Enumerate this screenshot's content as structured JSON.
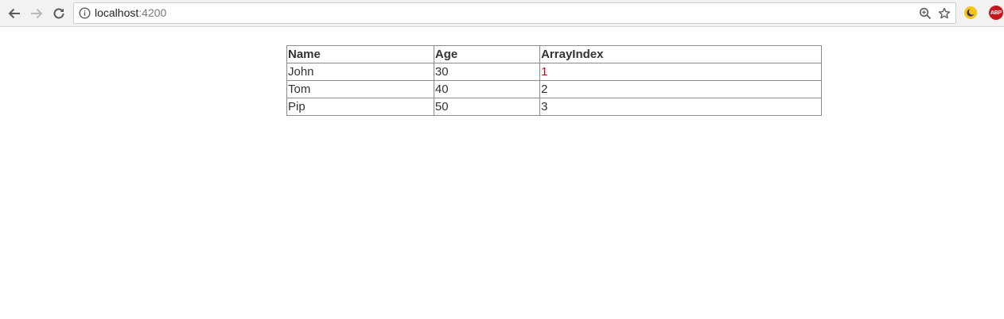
{
  "browser": {
    "url_host": "localhost",
    "url_port": ":4200",
    "icons": {
      "back": "arrow-left-icon",
      "forward": "arrow-right-icon",
      "reload": "reload-icon",
      "site_info": "info-icon",
      "zoom": "zoom-in-icon",
      "bookmark": "star-icon",
      "extension_1": "moon-icon",
      "extension_2": "adblock-plus-icon"
    },
    "adblock_label": "ABP"
  },
  "table": {
    "headers": [
      "Name",
      "Age",
      "ArrayIndex"
    ],
    "rows": [
      {
        "name": "John",
        "age": "30",
        "index": "1",
        "highlight": true
      },
      {
        "name": "Tom",
        "age": "40",
        "index": "2",
        "highlight": false
      },
      {
        "name": "Pip",
        "age": "50",
        "index": "3",
        "highlight": false
      }
    ],
    "highlight_color": "#d0021b",
    "text_color": "#333333"
  }
}
